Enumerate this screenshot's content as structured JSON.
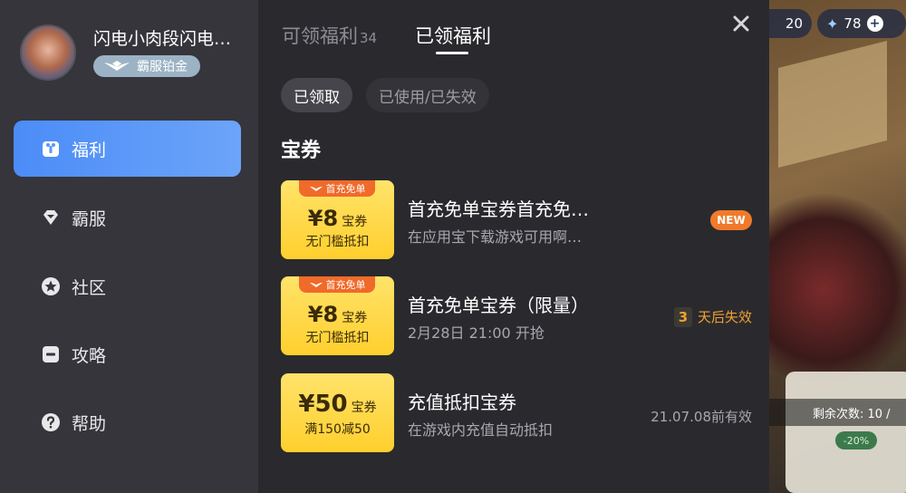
{
  "hud": {
    "left_value": "20",
    "gem_value": "78",
    "remaining_label": "剩余次数: 10 /",
    "discount": "-20%"
  },
  "user": {
    "name": "闪电小肉段闪电…",
    "vip_level": "霸服铂金"
  },
  "sidebar": {
    "items": [
      {
        "label": "福利",
        "icon": "gift-icon"
      },
      {
        "label": "霸服",
        "icon": "diamond-icon"
      },
      {
        "label": "社区",
        "icon": "star-icon"
      },
      {
        "label": "攻略",
        "icon": "guide-icon"
      },
      {
        "label": "帮助",
        "icon": "help-icon"
      }
    ]
  },
  "tabs": [
    {
      "label": "可领福利",
      "count": "34"
    },
    {
      "label": "已领福利"
    }
  ],
  "filters": {
    "received": "已领取",
    "used": "已使用/已失效"
  },
  "section_title": "宝券",
  "coupons": [
    {
      "tag": "首充免单",
      "amount": "¥8",
      "unit": "宝券",
      "condition": "无门槛抵扣",
      "title": "首充免单宝券首充免…",
      "subtitle": "在应用宝下载游戏可用啊…",
      "badge": "NEW"
    },
    {
      "tag": "首充免单",
      "amount": "¥8",
      "unit": "宝券",
      "condition": "无门槛抵扣",
      "title": "首充免单宝券（限量）",
      "subtitle": "2月28日 21:00 开抢",
      "days": "3",
      "days_suffix": "天后失效"
    },
    {
      "amount": "¥50",
      "unit": "宝券",
      "condition": "满150减50",
      "title": "充值抵扣宝券",
      "subtitle": "在游戏内充值自动抵扣",
      "expiry": "21.07.08前有效"
    }
  ],
  "colors": {
    "accent_blue": "#4b8cf7",
    "coupon_yellow": "#ffd84a",
    "new_orange": "#f07a2a",
    "expire_orange": "#f0a030"
  }
}
